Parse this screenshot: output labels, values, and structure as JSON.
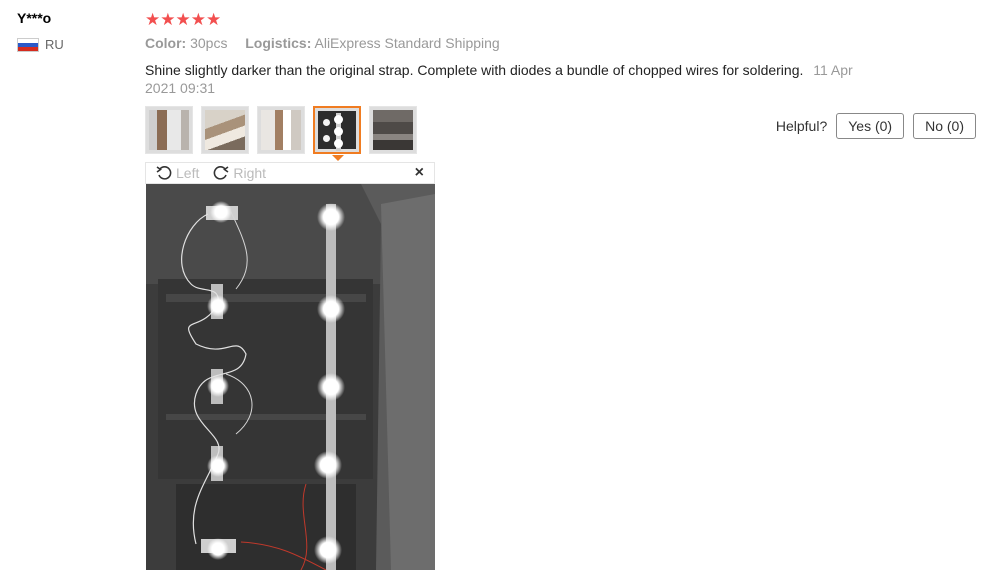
{
  "review": {
    "user_name": "Y***o",
    "country_code": "RU",
    "rating": 5,
    "stars": "★★★★★",
    "color_label": "Color:",
    "color_value": "30pcs",
    "logistics_label": "Logistics:",
    "logistics_value": "AliExpress Standard Shipping",
    "text": "Shine slightly darker than the original strap. Complete with diodes a bundle of chopped wires for soldering.",
    "date": "11 Apr 2021 09:31"
  },
  "helpful": {
    "label": "Helpful?",
    "yes_label": "Yes (0)",
    "no_label": "No (0)"
  },
  "viewer": {
    "rotate_left_label": "Left",
    "rotate_right_label": "Right",
    "close_glyph": "×",
    "selected_thumbnail": 4
  },
  "colors": {
    "star": "#f24f4f",
    "active_thumb_border": "#f07c21",
    "muted_text": "#999999"
  }
}
